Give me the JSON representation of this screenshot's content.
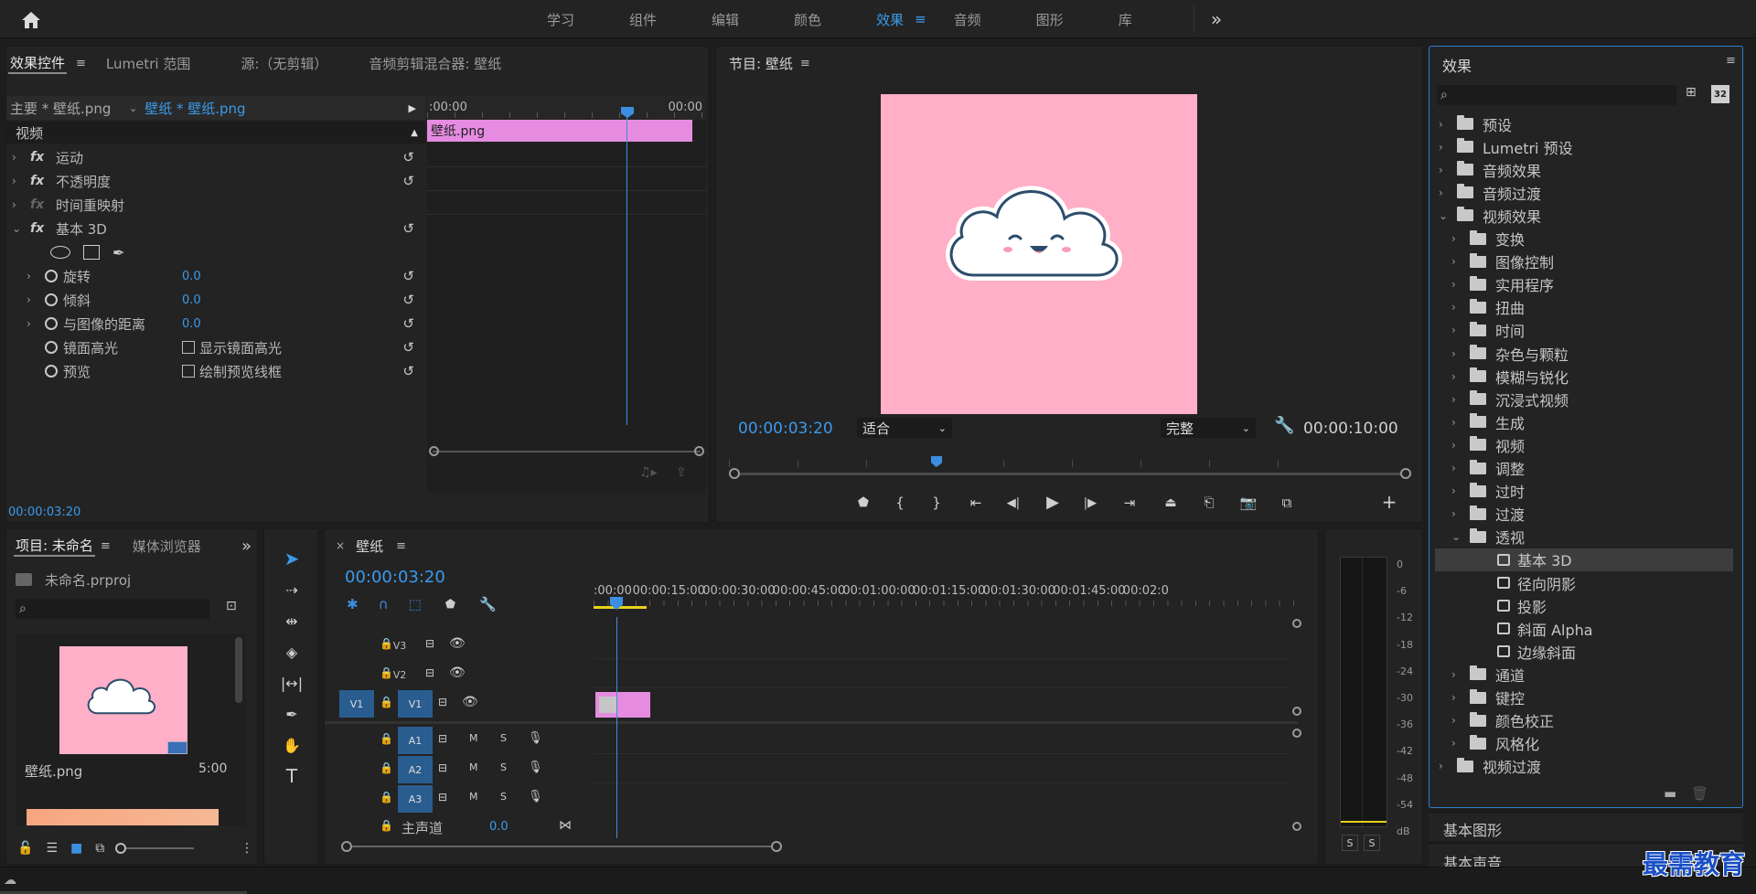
{
  "topbar": {
    "workspaces": [
      "学习",
      "组件",
      "编辑",
      "颜色",
      "效果",
      "音频",
      "图形",
      "库"
    ],
    "active_workspace": "效果",
    "more_icon": "»"
  },
  "effect_controls": {
    "tabs": [
      "效果控件",
      "Lumetri 范围",
      "源:（无剪辑）",
      "音频剪辑混合器: 壁纸"
    ],
    "master_label": "主要 * 壁纸.png",
    "clip_label": "壁纸 * 壁纸.png",
    "section_video": "视频",
    "effects": [
      {
        "name": "运动"
      },
      {
        "name": "不透明度"
      },
      {
        "name": "时间重映射"
      },
      {
        "name": "基本 3D"
      }
    ],
    "params": [
      {
        "name": "旋转",
        "value": "0.0"
      },
      {
        "name": "倾斜",
        "value": "0.0"
      },
      {
        "name": "与图像的距离",
        "value": "0.0"
      },
      {
        "name": "镜面高光",
        "checkbox": "显示镜面高光"
      },
      {
        "name": "预览",
        "checkbox": "绘制预览线框"
      }
    ],
    "mini_timeline_start": ":00:00",
    "mini_timeline_end": "00:00",
    "clip_name": "壁纸.png",
    "timecode": "00:00:03:20"
  },
  "program_monitor": {
    "title": "节目: 壁纸",
    "timecode": "00:00:03:20",
    "fit": "适合",
    "quality": "完整",
    "duration": "00:00:10:00",
    "background_color": "#ffafc8"
  },
  "effects_panel": {
    "title": "效果",
    "search_placeholder": "",
    "tree": [
      {
        "label": "预设",
        "level": 0,
        "type": "preset",
        "open": false
      },
      {
        "label": "Lumetri 预设",
        "level": 0,
        "type": "preset",
        "open": false
      },
      {
        "label": "音频效果",
        "level": 0,
        "type": "folder",
        "open": false
      },
      {
        "label": "音频过渡",
        "level": 0,
        "type": "folder",
        "open": false
      },
      {
        "label": "视频效果",
        "level": 0,
        "type": "folder",
        "open": true
      },
      {
        "label": "变换",
        "level": 1,
        "type": "folder",
        "open": false
      },
      {
        "label": "图像控制",
        "level": 1,
        "type": "folder",
        "open": false
      },
      {
        "label": "实用程序",
        "level": 1,
        "type": "folder",
        "open": false
      },
      {
        "label": "扭曲",
        "level": 1,
        "type": "folder",
        "open": false
      },
      {
        "label": "时间",
        "level": 1,
        "type": "folder",
        "open": false
      },
      {
        "label": "杂色与颗粒",
        "level": 1,
        "type": "folder",
        "open": false
      },
      {
        "label": "模糊与锐化",
        "level": 1,
        "type": "folder",
        "open": false
      },
      {
        "label": "沉浸式视频",
        "level": 1,
        "type": "folder",
        "open": false
      },
      {
        "label": "生成",
        "level": 1,
        "type": "folder",
        "open": false
      },
      {
        "label": "视频",
        "level": 1,
        "type": "folder",
        "open": false
      },
      {
        "label": "调整",
        "level": 1,
        "type": "folder",
        "open": false
      },
      {
        "label": "过时",
        "level": 1,
        "type": "folder",
        "open": false
      },
      {
        "label": "过渡",
        "level": 1,
        "type": "folder",
        "open": false
      },
      {
        "label": "透视",
        "level": 1,
        "type": "folder",
        "open": true
      },
      {
        "label": "基本 3D",
        "level": 2,
        "type": "effect",
        "selected": true
      },
      {
        "label": "径向阴影",
        "level": 2,
        "type": "effect"
      },
      {
        "label": "投影",
        "level": 2,
        "type": "effect"
      },
      {
        "label": "斜面 Alpha",
        "level": 2,
        "type": "effect"
      },
      {
        "label": "边缘斜面",
        "level": 2,
        "type": "effect"
      },
      {
        "label": "通道",
        "level": 1,
        "type": "folder",
        "open": false
      },
      {
        "label": "键控",
        "level": 1,
        "type": "folder",
        "open": false
      },
      {
        "label": "颜色校正",
        "level": 1,
        "type": "folder",
        "open": false
      },
      {
        "label": "风格化",
        "level": 1,
        "type": "folder",
        "open": false
      },
      {
        "label": "视频过渡",
        "level": 0,
        "type": "folder",
        "open": false
      }
    ],
    "bottom_sections": [
      "基本图形",
      "基本声音"
    ]
  },
  "project_panel": {
    "tabs": [
      "项目: 未命名",
      "媒体浏览器"
    ],
    "project_file": "未命名.prproj",
    "item_name": "壁纸.png",
    "item_duration": "5:00"
  },
  "timeline": {
    "title": "壁纸",
    "timecode": "00:00:03:20",
    "ruler": [
      ":00:00",
      "00:00:15:00",
      "00:00:30:00",
      "00:00:45:00",
      "00:01:00:00",
      "00:01:15:00",
      "00:01:30:00",
      "00:01:45:00",
      "00:02:0"
    ],
    "video_tracks": [
      "V3",
      "V2",
      "V1"
    ],
    "audio_tracks": [
      "A1",
      "A2",
      "A3"
    ],
    "source_patch": "V1",
    "master_label": "主声道",
    "master_value": "0.0",
    "m_label": "M",
    "s_label": "S"
  },
  "audio_meter": {
    "scale": [
      "0",
      "-6",
      "-12",
      "-18",
      "-24",
      "-30",
      "-36",
      "-42",
      "-48",
      "-54",
      "dB"
    ],
    "solo": [
      "S",
      "S"
    ]
  },
  "watermark": "最需教育"
}
